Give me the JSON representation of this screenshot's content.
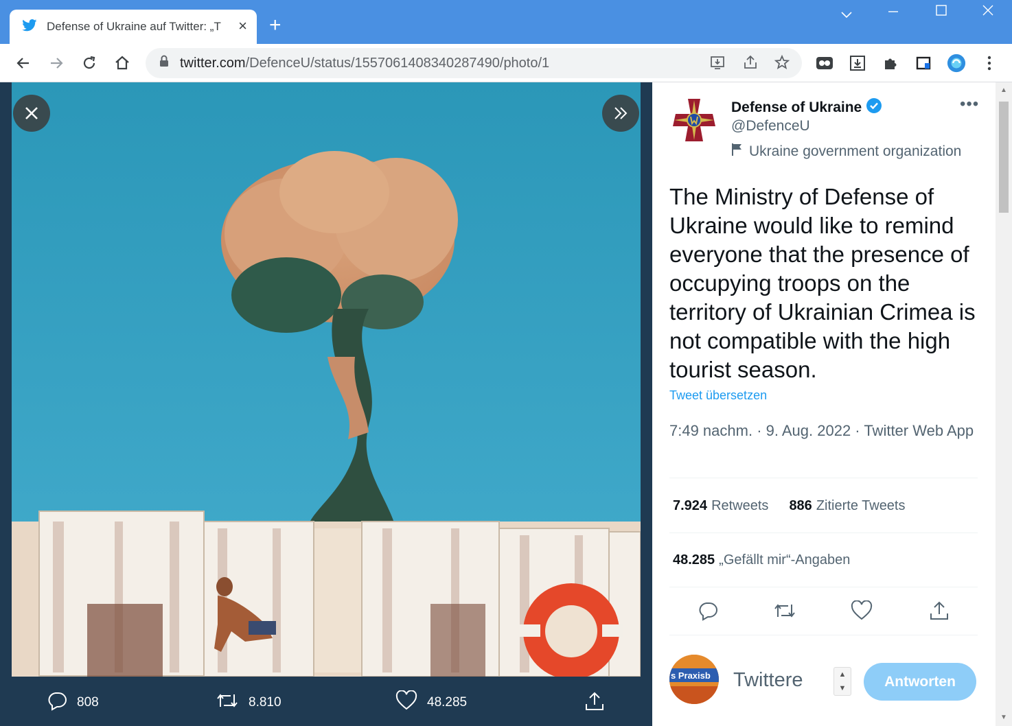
{
  "browser": {
    "tab_title": "Defense of Ukraine auf Twitter: „T",
    "url_domain": "twitter.com",
    "url_path": "/DefenceU/status/1557061408340287490/photo/1"
  },
  "viewer": {
    "reply_count": "808",
    "retweet_count": "8.810",
    "like_count": "48.285"
  },
  "tweet": {
    "display_name": "Defense of Ukraine",
    "handle": "@DefenceU",
    "label": "Ukraine government organization",
    "text": "The Ministry of Defense of Ukraine would like to remind everyone that the presence of occupying troops on the territory of Ukrainian Crimea is not compatible with the high tourist season.",
    "translate": "Tweet übersetzen",
    "timestamp": "7:49 nachm. · 9. Aug. 2022 · Twitter Web App",
    "retweets_num": "7.924",
    "retweets_label": "Retweets",
    "quotes_num": "886",
    "quotes_label": "Zitierte Tweets",
    "likes_num": "48.285",
    "likes_label": "„Gefällt mir“-Angaben"
  },
  "reply": {
    "placeholder": "Twittere",
    "button": "Antworten",
    "avatar_text": "s Praxisb"
  },
  "colors": {
    "chrome_blue": "#4a90e2",
    "twitter_blue": "#1d9bf0",
    "reply_button": "#8ecdf8",
    "viewer_bg": "#1f3a52"
  }
}
